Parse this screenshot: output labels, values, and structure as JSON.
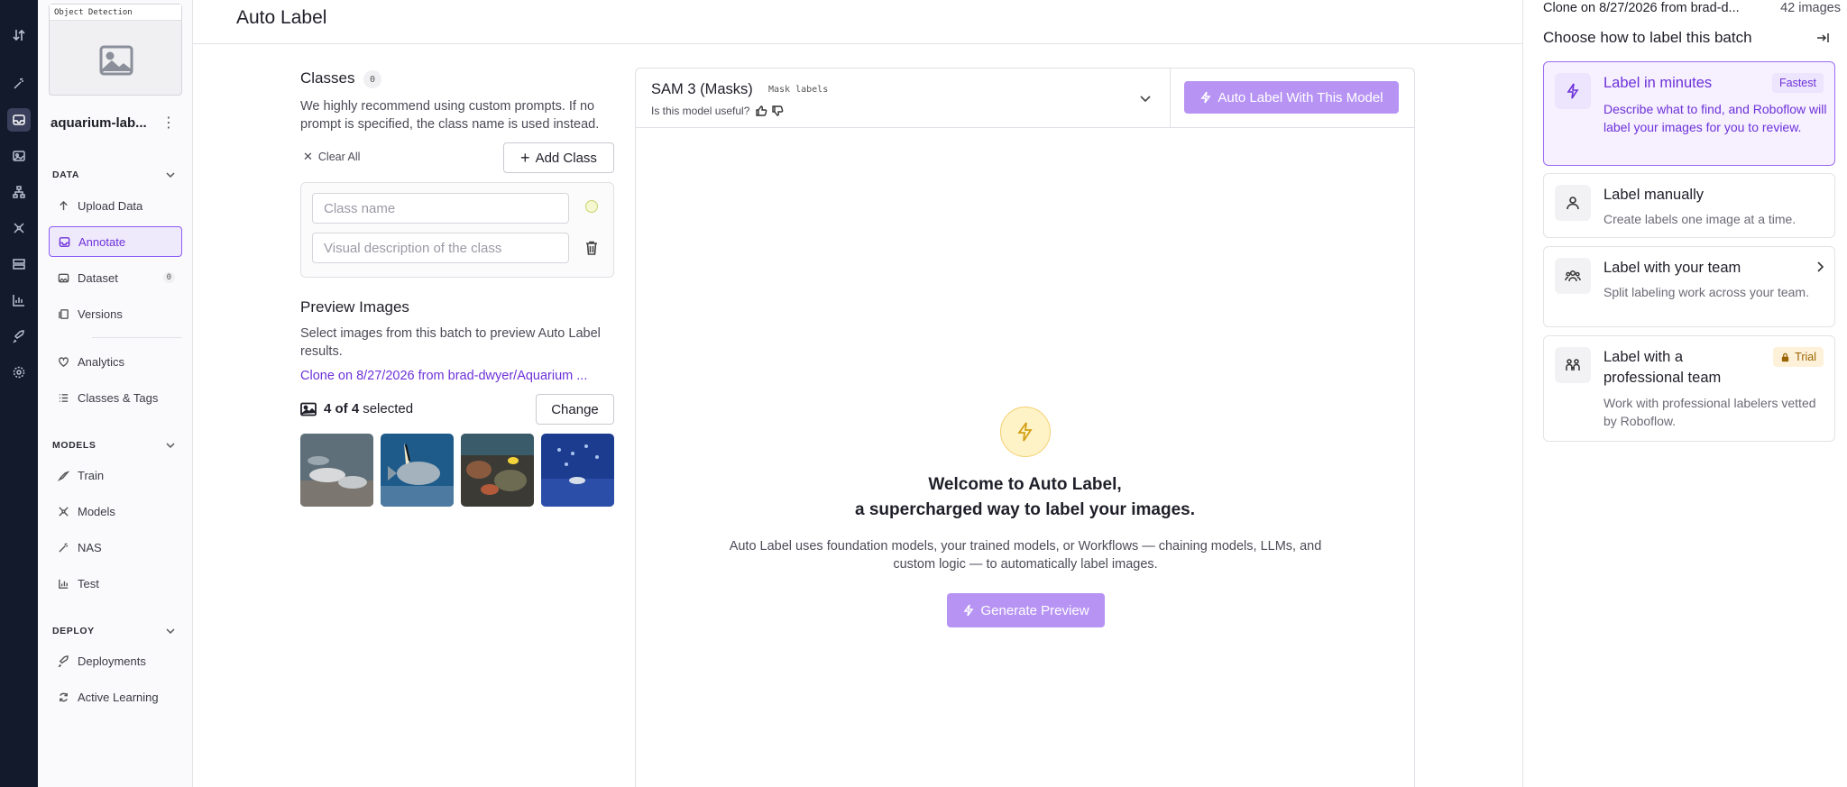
{
  "main_title": "Auto Label",
  "project": {
    "type_tag": "Object Detection",
    "name": "aquarium-lab..."
  },
  "sidebar": {
    "data_section": "DATA",
    "data_items": [
      {
        "label": "Upload Data"
      },
      {
        "label": "Annotate"
      },
      {
        "label": "Dataset",
        "badge": "0"
      },
      {
        "label": "Versions"
      },
      {
        "label": "Analytics"
      },
      {
        "label": "Classes & Tags"
      }
    ],
    "models_section": "MODELS",
    "models_items": [
      {
        "label": "Train"
      },
      {
        "label": "Models"
      },
      {
        "label": "NAS"
      },
      {
        "label": "Test"
      }
    ],
    "deploy_section": "DEPLOY",
    "deploy_items": [
      {
        "label": "Deployments"
      },
      {
        "label": "Active Learning"
      }
    ]
  },
  "classes": {
    "title": "Classes",
    "count": "0",
    "hint": "We highly recommend using custom prompts. If no prompt is specified, the class name is used instead.",
    "clear_all": "Clear All",
    "add_class": "Add Class",
    "name_placeholder": "Class name",
    "desc_placeholder": "Visual description of the class"
  },
  "preview": {
    "title": "Preview Images",
    "hint": "Select images from this batch to preview Auto Label results.",
    "batch_link": "Clone on 8/27/2026 from brad-dwyer/Aquarium ...",
    "selected_count": "4 of 4",
    "selected_suffix": "selected",
    "change": "Change"
  },
  "model": {
    "name": "SAM 3 (Masks)",
    "tag": "Mask labels",
    "useful_question": "Is this model useful?",
    "auto_label_button": "Auto Label With This Model",
    "welcome_line1": "Welcome to Auto Label,",
    "welcome_line2": "a supercharged way to label your images.",
    "description": "Auto Label uses foundation models, your trained models, or Workflows — chaining models, LLMs, and custom logic — to automatically label images.",
    "generate_button": "Generate Preview"
  },
  "drawer": {
    "batch_name": "Clone on 8/27/2026 from brad-d...",
    "image_count": "42 images",
    "title": "Choose how to label this batch",
    "options": [
      {
        "title": "Label in minutes",
        "pill": "Fastest",
        "desc": "Describe what to find, and Roboflow will label your images for you to review."
      },
      {
        "title": "Label manually",
        "desc": "Create labels one image at a time."
      },
      {
        "title": "Label with your team",
        "desc": "Split labeling work across your team."
      },
      {
        "title": "Label with a professional team",
        "pill": "Trial",
        "desc": "Work with professional labelers vetted by Roboflow."
      }
    ]
  },
  "colors": {
    "accent": "#6d32d9",
    "accent_light": "#b794f4",
    "rail_bg": "#121a2b"
  }
}
